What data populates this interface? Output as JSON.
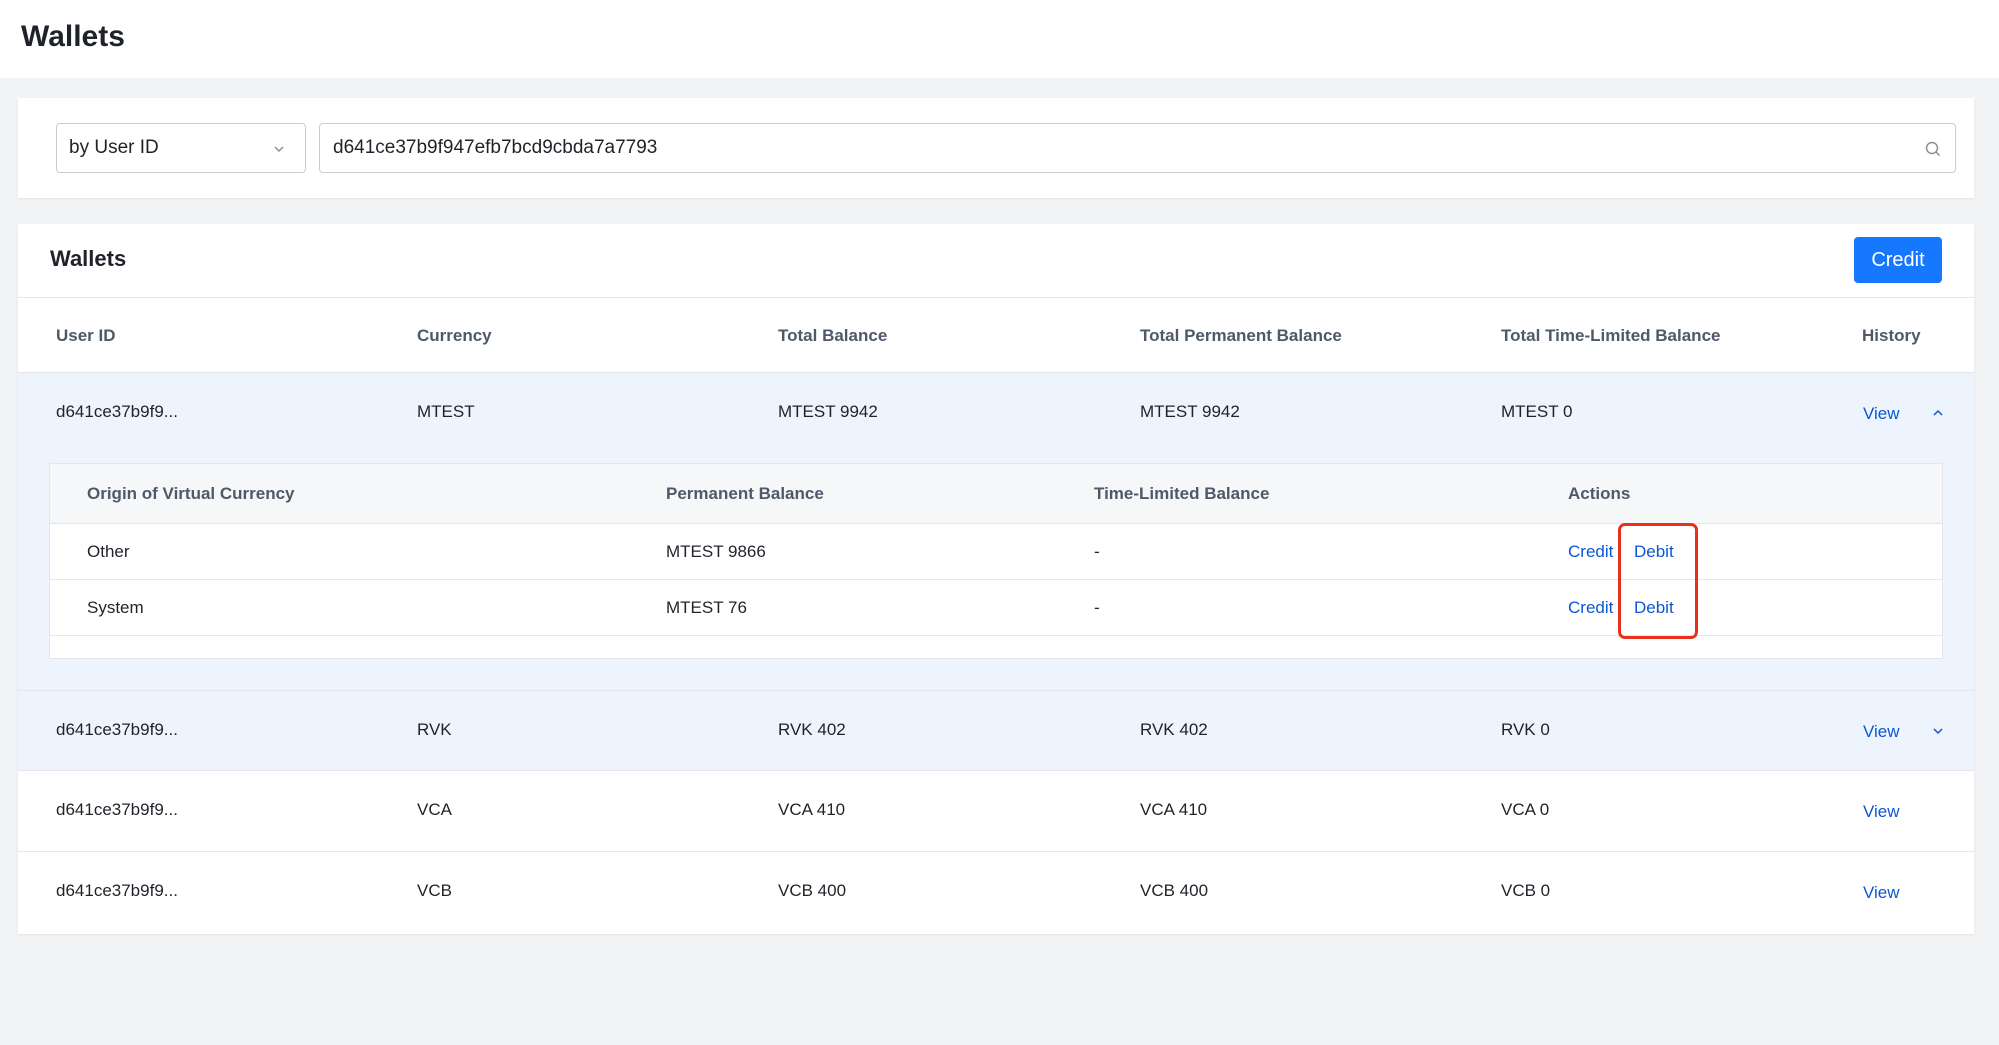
{
  "page": {
    "title": "Wallets"
  },
  "search": {
    "filter_selected": "by User ID",
    "value": "d641ce37b9f947efb7bcd9cbda7a7793"
  },
  "wallets": {
    "title": "Wallets",
    "credit_button": "Credit",
    "columns": [
      "User ID",
      "Currency",
      "Total Balance",
      "Total Permanent Balance",
      "Total Time-Limited Balance",
      "History"
    ],
    "rows": [
      {
        "user_id": "d641ce37b9f9...",
        "currency": "MTEST",
        "total": "MTEST 9942",
        "permanent": "MTEST 9942",
        "time_limited": "MTEST 0",
        "history": "View"
      },
      {
        "user_id": "d641ce37b9f9...",
        "currency": "RVK",
        "total": "RVK 402",
        "permanent": "RVK 402",
        "time_limited": "RVK 0",
        "history": "View"
      },
      {
        "user_id": "d641ce37b9f9...",
        "currency": "VCA",
        "total": "VCA 410",
        "permanent": "VCA 410",
        "time_limited": "VCA 0",
        "history": "View"
      },
      {
        "user_id": "d641ce37b9f9...",
        "currency": "VCB",
        "total": "VCB 400",
        "permanent": "VCB 400",
        "time_limited": "VCB 0",
        "history": "View"
      }
    ],
    "detail": {
      "columns": [
        "Origin of Virtual Currency",
        "Permanent Balance",
        "Time-Limited Balance",
        "Actions"
      ],
      "rows": [
        {
          "origin": "Other",
          "permanent": "MTEST 9866",
          "time_limited": "-",
          "credit": "Credit",
          "debit": "Debit"
        },
        {
          "origin": "System",
          "permanent": "MTEST 76",
          "time_limited": "-",
          "credit": "Credit",
          "debit": "Debit"
        }
      ]
    }
  },
  "colors": {
    "primary": "#1677ff",
    "link": "#0b57d0",
    "highlight": "#e8301c",
    "expanded_row_bg": "#edf4fd"
  }
}
